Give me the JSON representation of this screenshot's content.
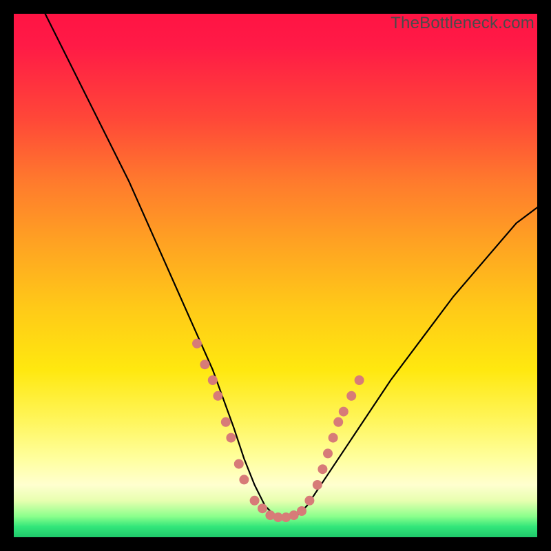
{
  "watermark": "TheBottleneck.com",
  "chart_data": {
    "type": "line",
    "title": "",
    "xlabel": "",
    "ylabel": "",
    "xlim": [
      0,
      100
    ],
    "ylim": [
      0,
      100
    ],
    "grid": false,
    "legend": false,
    "background_gradient": {
      "orientation": "vertical",
      "stops": [
        {
          "pos": 0,
          "color": "#ff1444"
        },
        {
          "pos": 50,
          "color": "#ffc000"
        },
        {
          "pos": 85,
          "color": "#ffff9e"
        },
        {
          "pos": 100,
          "color": "#1fc86b"
        }
      ]
    },
    "series": [
      {
        "name": "bottleneck-curve",
        "color": "#000000",
        "x": [
          6,
          10,
          14,
          18,
          22,
          26,
          30,
          34,
          38,
          42,
          44,
          46,
          48,
          50,
          52,
          54,
          56,
          60,
          66,
          72,
          78,
          84,
          90,
          96,
          100
        ],
        "y": [
          100,
          92,
          84,
          76,
          68,
          59,
          50,
          41,
          32,
          21,
          15,
          10,
          6,
          4,
          3.5,
          4,
          6,
          12,
          21,
          30,
          38,
          46,
          53,
          60,
          63
        ]
      }
    ],
    "markers": {
      "name": "highlight-dots",
      "color": "#d77b78",
      "radius": 7,
      "points": [
        {
          "x": 35,
          "y": 37
        },
        {
          "x": 36.5,
          "y": 33
        },
        {
          "x": 38,
          "y": 30
        },
        {
          "x": 39,
          "y": 27
        },
        {
          "x": 40.5,
          "y": 22
        },
        {
          "x": 41.5,
          "y": 19
        },
        {
          "x": 43,
          "y": 14
        },
        {
          "x": 44,
          "y": 11
        },
        {
          "x": 46,
          "y": 7
        },
        {
          "x": 47.5,
          "y": 5.5
        },
        {
          "x": 49,
          "y": 4.2
        },
        {
          "x": 50.5,
          "y": 3.8
        },
        {
          "x": 52,
          "y": 3.8
        },
        {
          "x": 53.5,
          "y": 4.2
        },
        {
          "x": 55,
          "y": 5
        },
        {
          "x": 56.5,
          "y": 7
        },
        {
          "x": 58,
          "y": 10
        },
        {
          "x": 59,
          "y": 13
        },
        {
          "x": 60,
          "y": 16
        },
        {
          "x": 61,
          "y": 19
        },
        {
          "x": 62,
          "y": 22
        },
        {
          "x": 63,
          "y": 24
        },
        {
          "x": 64.5,
          "y": 27
        },
        {
          "x": 66,
          "y": 30
        }
      ]
    }
  }
}
